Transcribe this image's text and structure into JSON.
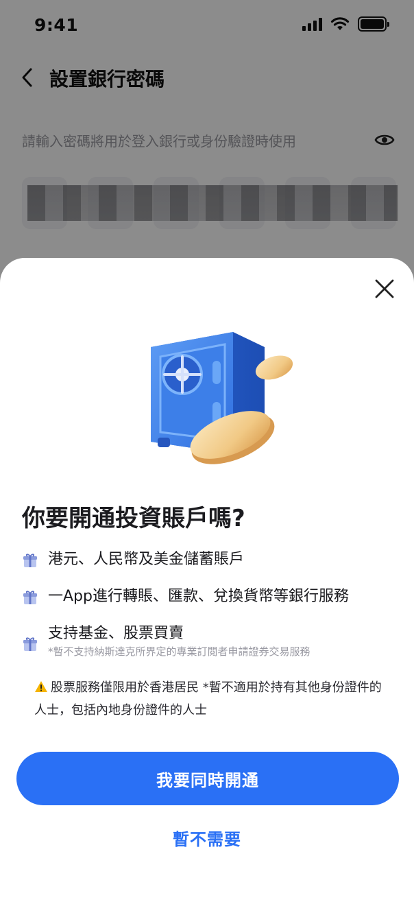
{
  "status_bar": {
    "time": "9:41"
  },
  "background_page": {
    "title": "設置銀行密碼",
    "pin_hint": "請輸入密碼將用於登入銀行或身份驗證時使用",
    "pin_length": 6
  },
  "sheet": {
    "title": "你要開通投資賬戶嗎?",
    "benefits": [
      {
        "text": "港元、人民幣及美金儲蓄賬戶",
        "note": ""
      },
      {
        "text": "一App進行轉賬、匯款、兌換貨幣等銀行服務",
        "note": ""
      },
      {
        "text": "支持基金、股票買賣",
        "note": "*暫不支持納斯達克所界定的專業訂閱者申請證券交易服務"
      }
    ],
    "warning": "股票服務僅限用於香港居民 *暫不適用於持有其他身份證件的人士，包括內地身份證件的人士",
    "primary_button": "我要同時開通",
    "secondary_button": "暫不需要"
  },
  "colors": {
    "accent": "#2a70f5",
    "overlay": "rgba(0,0,0,0.45)",
    "gift_icon": "#8a9bdc",
    "warning_icon": "#f5b400"
  },
  "icons": {
    "back": "chevron-left-icon",
    "eye": "eye-icon",
    "close": "close-icon",
    "gift": "gift-icon",
    "warning": "warning-icon"
  }
}
